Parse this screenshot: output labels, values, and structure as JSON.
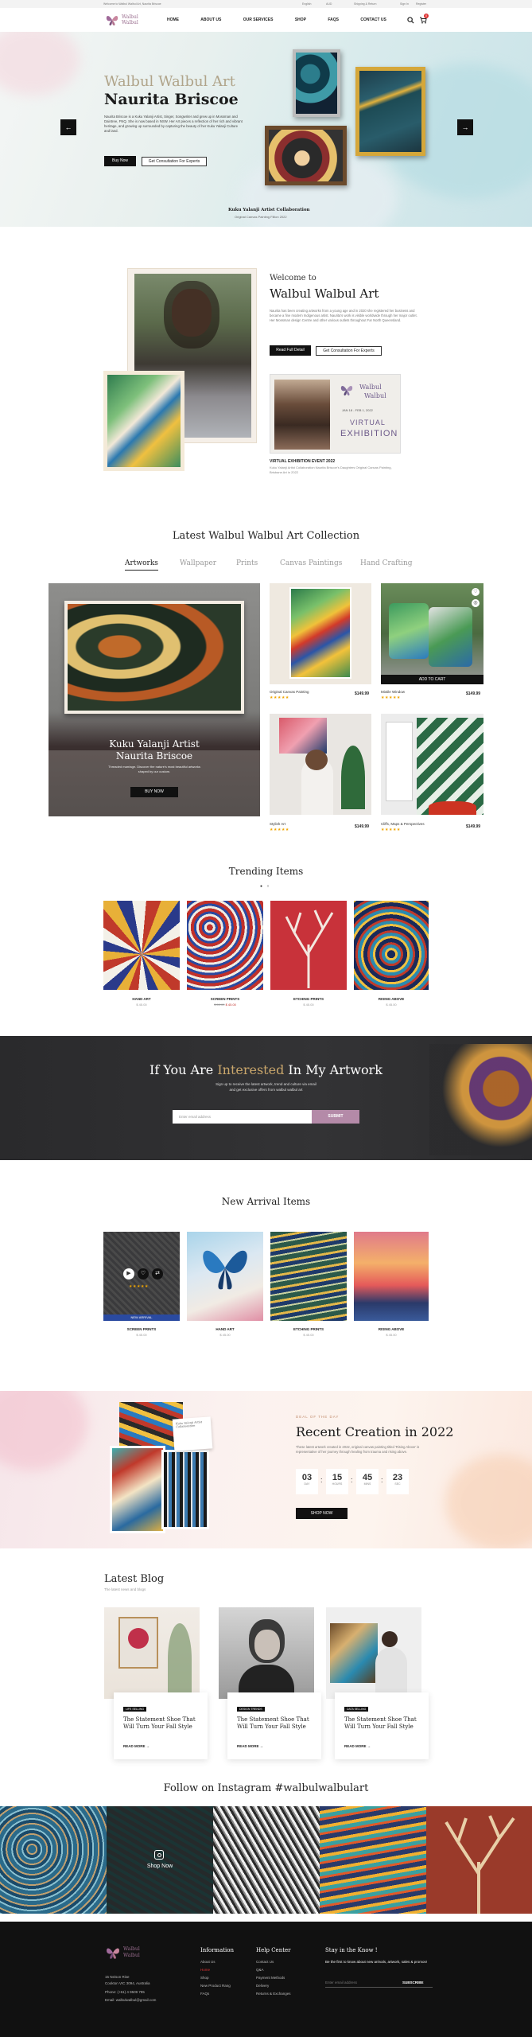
{
  "topbar": {
    "welcome": "Welcome to Walbul Walbul Art, Naurita Briscoe",
    "currency": "English",
    "lang": "AUD",
    "shipping": "Shipping & Return",
    "signin": "Sign In",
    "register": "Register"
  },
  "nav": {
    "logo_line1": "Walbul",
    "logo_line2": "Walbul",
    "items": [
      "HOME",
      "ABOUT US",
      "OUR SERVICES",
      "SHOP",
      "FAQS",
      "CONTACT US"
    ],
    "cart_count": "0"
  },
  "hero": {
    "title1": "Walbul Walbul Art",
    "title2": "Naurita Briscoe",
    "body": "Naurita Briscoe is a Kuku Yalanji Artist, Singer, Songwriter and grew up in Mossman and Daintree, FNQ. She is now based in NSW. Her Art pieces a reflection of her rich and vibrant heritage, and growing up surrounded by capturing the beauty of her Kuku Yalanji Culture and land.",
    "btn_buy": "Buy Now",
    "btn_consult": "Get Consultation For Experts",
    "caption_title": "Kuku Yalanji Artist Collaboration",
    "caption_sub": "Original Canvas Painting Fillion 2022",
    "prev": "←",
    "next": "→"
  },
  "welcome": {
    "sub": "Welcome to",
    "title": "Walbul Walbul Art",
    "body": "Naurita has been creating artworks from a young age and in 2020 she registered her business and became a fine modern Indigenous artist. Naurita's work is visible worldwide through her major outlet. Her Mossman design Centre and other various outlets throughout Far North Queensland.",
    "btn_detail": "Read Full Detail",
    "btn_consult": "Get Consultation For Experts",
    "event_title": "VIRTUAL EXHIBITION EVENT 2022",
    "event_body": "Kuku Yalanji Artist Collaboration Naurita Briscoe's Daughters Original Canvas Painting, Brisbane Art in 2022",
    "poster_title1": "Walbul",
    "poster_title2": "Walbul",
    "poster_date": "JAN 18 - FEB 1, 2022",
    "poster_virtual": "VIRTUAL",
    "poster_exhibition": "EXHIBITION"
  },
  "collection": {
    "title": "Latest Walbul Walbul Art Collection",
    "tabs": [
      "Artworks",
      "Wallpaper",
      "Prints",
      "Canvas Paintings",
      "Hand Crafting"
    ],
    "feature_line1": "Kuku Yalanji Artist",
    "feature_line2": "Naurita Briscoe",
    "feature_body": "Threaded marriage. Discover the nature's most beautiful artworks shaped by our custom.",
    "feature_btn": "BUY NOW",
    "add_to_cart": "ADD TO CART",
    "products": [
      {
        "name": "Original Canvas Painting",
        "price": "$149.99",
        "stars": "★★★★★"
      },
      {
        "name": "Mixtile Window",
        "price": "$149.99",
        "stars": "★★★★★"
      },
      {
        "name": "Stylish Art",
        "price": "$149.99",
        "stars": "★★★★★"
      },
      {
        "name": "Cliffs, Maps & Perspectives",
        "price": "$149.99",
        "stars": "★★★★★"
      }
    ]
  },
  "trending": {
    "title": "Trending Items",
    "items": [
      {
        "name": "HAND ART",
        "price": "$ 45.00",
        "old": ""
      },
      {
        "name": "SCREEN PRINTS",
        "price": "$ 45.00",
        "old": "$ 65.00"
      },
      {
        "name": "ETCHING PRINTS",
        "price": "$ 45.00",
        "old": ""
      },
      {
        "name": "RISING ABOVE",
        "price": "$ 45.00",
        "old": ""
      }
    ]
  },
  "interest": {
    "title_a": "If You Are",
    "title_b": "Interested",
    "title_c": "In My Artwork",
    "sub1": "Sign up to receive the latest artwork, trend and culture via email",
    "sub2": "and get exclusive offers from walbul walbul art",
    "placeholder": "Enter email address",
    "btn": "SUBMIT"
  },
  "arrivals": {
    "title": "New Arrival Items",
    "badge": "NEW ARRIVAL",
    "items": [
      {
        "name": "SCREEN PRINTS",
        "price": "$ 45.00",
        "stars": "★★★★★"
      },
      {
        "name": "HAND ART",
        "price": "$ 45.00"
      },
      {
        "name": "ETCHING PRINTS",
        "price": "$ 45.00"
      },
      {
        "name": "RISING ABOVE",
        "price": "$ 45.00"
      }
    ]
  },
  "recent": {
    "eyebrow": "DEAL OF THE DAY",
    "title": "Recent Creation in 2022",
    "body": "These latest artwork created in 2022, original canvas painting titled 'Rising Above' is representative of her journey through healing from trauma and rising above.",
    "card_title": "Kuku Yalanji Artist Collaboration",
    "countdown": [
      {
        "n": "03",
        "l": "DAY"
      },
      {
        "n": "15",
        "l": "HOURS"
      },
      {
        "n": "45",
        "l": "MINS"
      },
      {
        "n": "23",
        "l": "SEC"
      }
    ],
    "btn": "SHOP NOW"
  },
  "blog": {
    "title": "Latest Blog",
    "sub": "The latest news and blogs",
    "posts": [
      {
        "tag": "LIFE SELLING",
        "title": "The Statement Shoe That Will Turn Your Fall Style",
        "link": "READ MORE"
      },
      {
        "tag": "DESIGN TRENDS",
        "title": "The Statement Shoe That Will Turn Your Fall Style",
        "link": "READ MORE"
      },
      {
        "tag": "DATA SELLING",
        "title": "The Statement Shoe That Will Turn Your Fall Style",
        "link": "READ MORE"
      }
    ]
  },
  "instagram": {
    "title": "Follow on Instagram #walbulwalbulart",
    "shop": "Shop Now"
  },
  "footer": {
    "logo_line1": "Walbul",
    "logo_line2": "Walbul",
    "address1": "15 Neison Rise",
    "address2": "Cookton VIC 3094, Australia",
    "phone": "Phone: (+61) 4 9509 785",
    "email": "Email: walbulwalbul@gmail.com",
    "info_h": "Information",
    "info": [
      "About Us",
      "Home",
      "Shop",
      "New Product Rang",
      "FAQs"
    ],
    "help_h": "Help Center",
    "help": [
      "Contact Us",
      "Q&A",
      "Payment Methods",
      "Delivery",
      "Returns & Exchanges"
    ],
    "stay_h": "Stay in the Know !",
    "stay_body": "Be the first to know about new arrivals, artwork, sales & promos!",
    "stay_placeholder": "Enter email address",
    "stay_btn": "SUBSCRIBE"
  }
}
